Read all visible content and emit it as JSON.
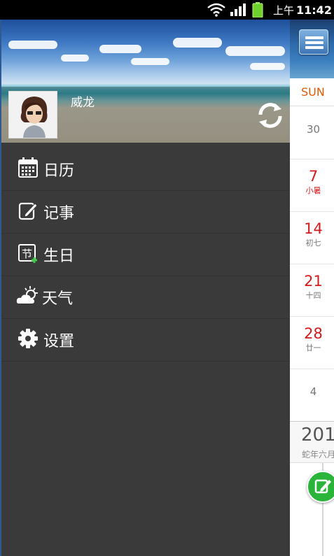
{
  "status_bar": {
    "time_prefix": "上午",
    "time": "11:42",
    "icons": [
      "wifi-icon",
      "signal-icon",
      "battery-icon"
    ]
  },
  "drawer": {
    "username": "威龙",
    "menu_items": [
      {
        "icon": "calendar-icon",
        "label": "日历"
      },
      {
        "icon": "note-icon",
        "label": "记事"
      },
      {
        "icon": "birthday-icon",
        "label": "生日"
      },
      {
        "icon": "weather-icon",
        "label": "天气"
      },
      {
        "icon": "gear-icon",
        "label": "设置"
      }
    ],
    "sync_icon": "sync-icon"
  },
  "calendar": {
    "weekday": "SUN",
    "days": [
      {
        "day": "30",
        "sub": ""
      },
      {
        "day": "7",
        "sub": "小暑"
      },
      {
        "day": "14",
        "sub": "初七"
      },
      {
        "day": "21",
        "sub": "十四"
      },
      {
        "day": "28",
        "sub": "廿一"
      },
      {
        "day": "4",
        "sub": ""
      }
    ],
    "year": "201",
    "year_sub": "蛇年六月"
  },
  "colors": {
    "drawer_bg": "#3a3a3a",
    "accent_red": "#d31b1b",
    "weekday_orange": "#e55a00",
    "fab_green": "#2bb43a"
  }
}
